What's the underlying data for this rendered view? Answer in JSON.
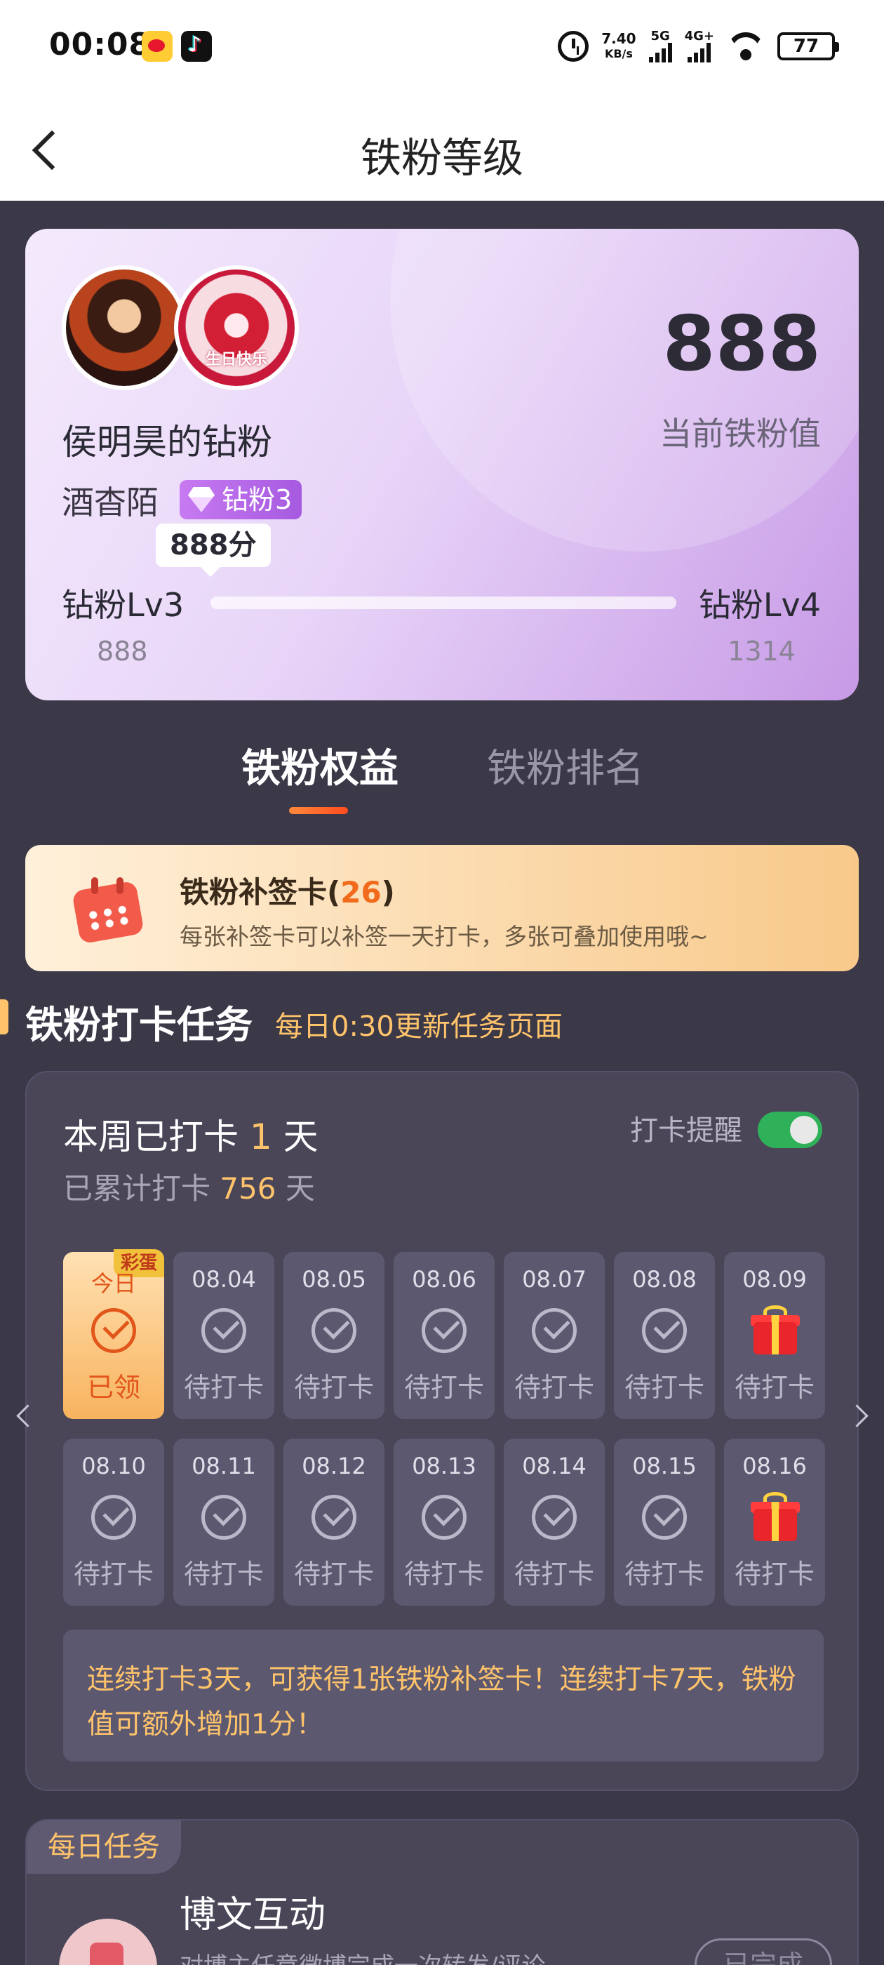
{
  "status_bar": {
    "time": "00:08",
    "net_speed": "7.40",
    "net_unit": "KB/s",
    "sig1": "5G",
    "sig2": "4G+",
    "battery": "77",
    "icons": [
      "weibo-icon",
      "tiktok-icon",
      "alarm-icon",
      "wifi-icon",
      "battery-icon"
    ]
  },
  "header": {
    "title": "铁粉等级"
  },
  "profile": {
    "fan_value": "888",
    "fan_value_label": "当前铁粉值",
    "fan_club": "侯明昊的钻粉",
    "username": "酒杳陌",
    "level_badge": "钻粉3",
    "badge_avatar_text": "生日快乐",
    "score_tip": "888分",
    "level_left": "钻粉Lv3",
    "level_right": "钻粉Lv4",
    "level_left_value": "888",
    "level_right_value": "1314",
    "progress_fraction": 0,
    "accent": "#c77af0"
  },
  "tabs": [
    {
      "label": "铁粉权益",
      "active": true
    },
    {
      "label": "铁粉排名",
      "active": false
    }
  ],
  "makeup_card": {
    "title": "铁粉补签卡",
    "count": "26",
    "desc": "每张补签卡可以补签一天打卡，多张可叠加使用哦~"
  },
  "checkin_section": {
    "title": "铁粉打卡任务",
    "subtitle": "每日0:30更新任务页面"
  },
  "checkin": {
    "week_prefix": "本周已打卡 ",
    "week_days": "1",
    "week_suffix": " 天",
    "total_prefix": "已累计打卡 ",
    "total_days": "756",
    "total_suffix": " 天",
    "remind_label": "打卡提醒",
    "remind_on": true,
    "egg_badge": "彩蛋",
    "days": [
      {
        "date": "今日",
        "status": "已领",
        "type": "today"
      },
      {
        "date": "08.04",
        "status": "待打卡",
        "type": "pending"
      },
      {
        "date": "08.05",
        "status": "待打卡",
        "type": "pending"
      },
      {
        "date": "08.06",
        "status": "待打卡",
        "type": "pending"
      },
      {
        "date": "08.07",
        "status": "待打卡",
        "type": "pending"
      },
      {
        "date": "08.08",
        "status": "待打卡",
        "type": "pending"
      },
      {
        "date": "08.09",
        "status": "待打卡",
        "type": "gift"
      },
      {
        "date": "08.10",
        "status": "待打卡",
        "type": "pending"
      },
      {
        "date": "08.11",
        "status": "待打卡",
        "type": "pending"
      },
      {
        "date": "08.12",
        "status": "待打卡",
        "type": "pending"
      },
      {
        "date": "08.13",
        "status": "待打卡",
        "type": "pending"
      },
      {
        "date": "08.14",
        "status": "待打卡",
        "type": "pending"
      },
      {
        "date": "08.15",
        "status": "待打卡",
        "type": "pending"
      },
      {
        "date": "08.16",
        "status": "待打卡",
        "type": "gift"
      }
    ],
    "note": "连续打卡3天，可获得1张铁粉补签卡！连续打卡7天，铁粉值可额外增加1分！"
  },
  "daily_tasks": {
    "tag": "每日任务",
    "task_title": "博文互动",
    "task_desc": "对博主任意微博完成一次转发/评论",
    "task_button": "已完成"
  }
}
